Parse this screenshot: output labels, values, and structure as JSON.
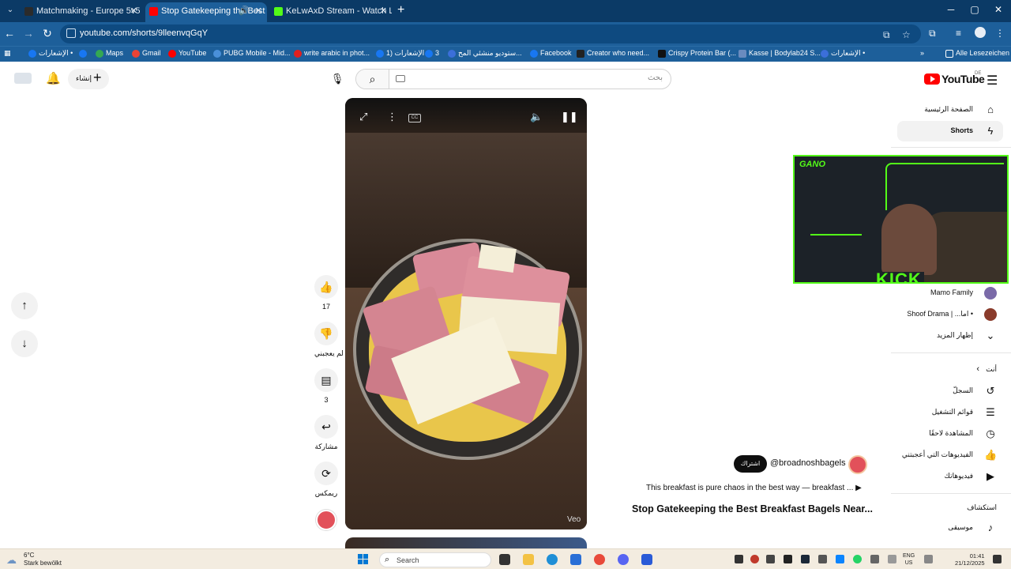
{
  "browser": {
    "tabs": [
      {
        "title": "Matchmaking - Europe 5v5 Qu",
        "favicon_color": "#2b2b2b"
      },
      {
        "title": "Stop Gatekeeping the Best",
        "favicon_color": "#ff0000",
        "active": true
      },
      {
        "title": "KeLwAxD Stream - Watch Live o",
        "favicon_color": "#53fc18"
      }
    ],
    "url": "youtube.com/shorts/9lleenvqGqY",
    "bookmarks": [
      "الإشعارات •",
      "",
      "Maps",
      "Gmail",
      "YouTube",
      "PUBG Mobile - Mid...",
      "write arabic in phot...",
      "الإشعارات (1",
      "3",
      "ستوديو منشئي المح...",
      "Facebook",
      "Creator who need...",
      "Crispy Protein Bar (...",
      "Kasse | Bodylab24 S...",
      "الإشعارات •"
    ],
    "all_bookmarks": "Alle Lesezeichen"
  },
  "youtube": {
    "logo_text": "YouTube",
    "country": "DE",
    "search_placeholder": "بحث",
    "create_label": "إنشاء",
    "sidebar": {
      "home": "الصفحة الرئيسية",
      "shorts": "Shorts",
      "subscriptions": [
        {
          "name": "Mamo Family",
          "color": "#7a6aa8"
        },
        {
          "name": "Shoof Drama | ...اما •",
          "color": "#8a3b2b"
        }
      ],
      "show_more": "إظهار المزيد",
      "you": "أنت",
      "you_items": [
        "السجلّ",
        "قوائم التشغيل",
        "المشاهدة لاحقًا",
        "الفيديوهات التي أعجبتني",
        "فيديوهاتك"
      ],
      "explore": "استكشاف",
      "music": "موسيقى"
    },
    "stream": {
      "label": "GANO",
      "brand": "KICK"
    },
    "actions": {
      "likes": "17",
      "dislike": "لم يعجبني",
      "comments": "3",
      "share": "مشاركة",
      "remix": "ريمكس"
    },
    "video": {
      "watermark": "Veo",
      "channel": "@broadnoshbagels",
      "subscribe": "اشتراك",
      "description": "This breakfast is pure chaos in the best way — breakfast ...",
      "title": "Stop Gatekeeping the Best Breakfast Bagels Near..."
    }
  },
  "taskbar": {
    "weather_temp": "6°C",
    "weather_desc": "Stark bewölkt",
    "search": "Search",
    "lang": "ENG",
    "region": "US",
    "time": "01:41",
    "date": "21/12/2025"
  }
}
